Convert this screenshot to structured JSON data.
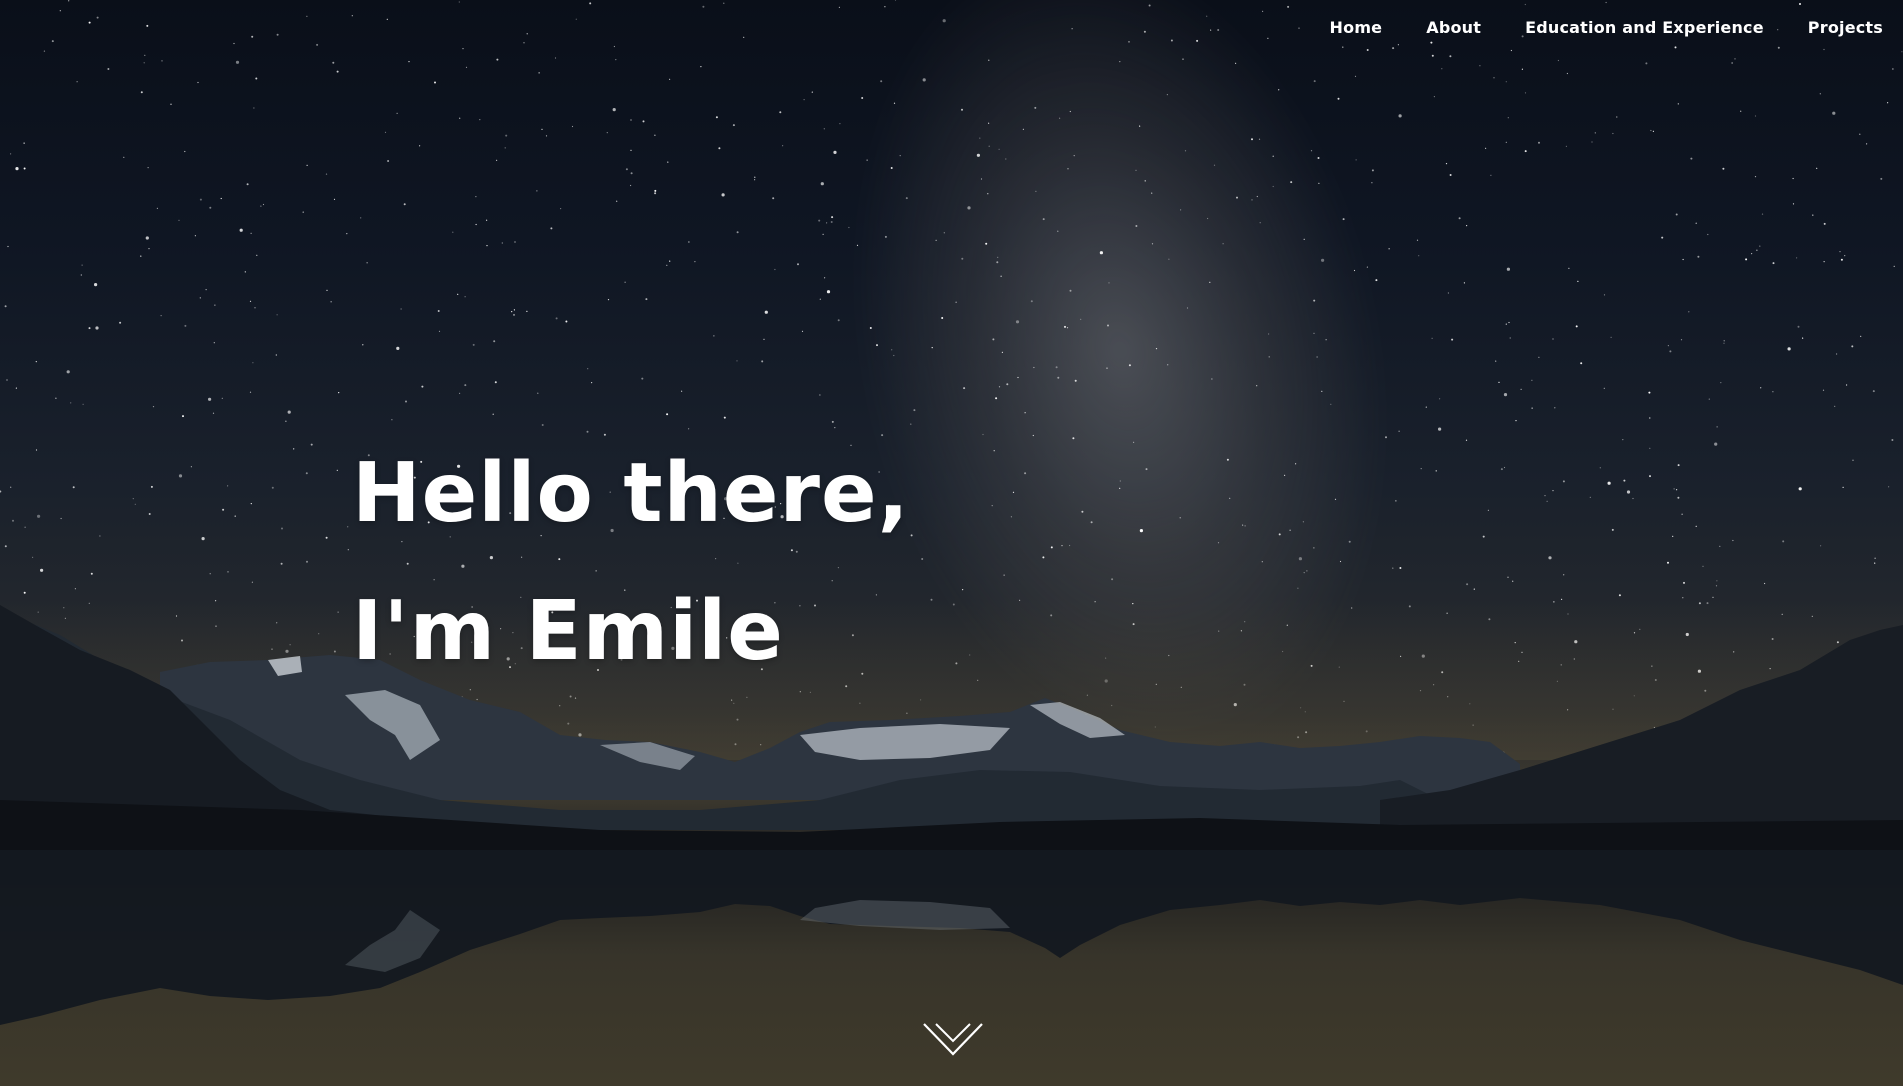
{
  "nav": {
    "items": [
      {
        "label": "Home"
      },
      {
        "label": "About"
      },
      {
        "label": "Education and Experience"
      },
      {
        "label": "Projects"
      }
    ]
  },
  "hero": {
    "line1": "Hello there,",
    "line2": "I'm Emile"
  },
  "scroll": {
    "icon": "chevron-down-icon"
  },
  "colors": {
    "text": "#ffffff",
    "sky": "#0f1623",
    "mountains": "#1d242d",
    "lake": "#2b2a22"
  }
}
